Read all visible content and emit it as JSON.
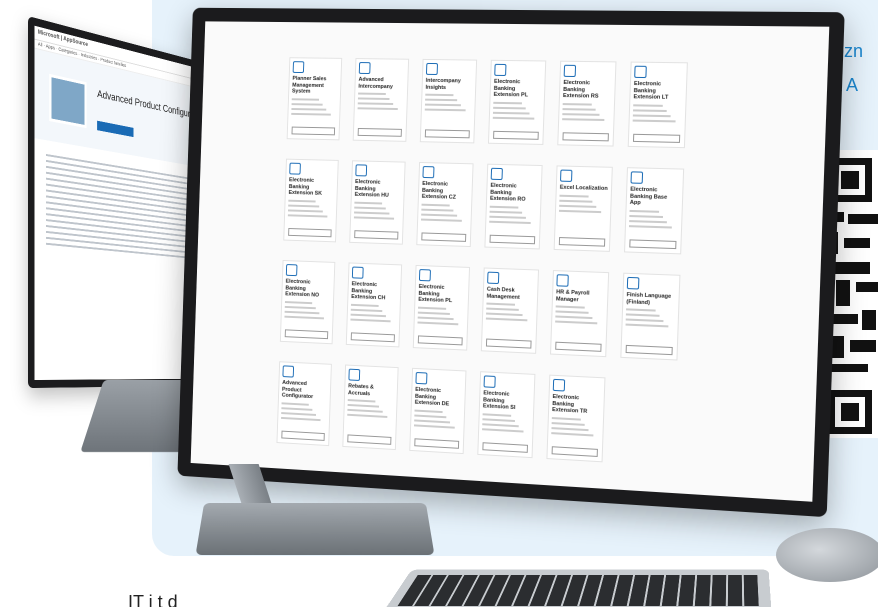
{
  "promo": {
    "line1": "Pozn",
    "line2": "na A"
  },
  "footer": {
    "text": "IT i t d"
  },
  "back_screen": {
    "brand": "Microsoft | AppSource",
    "nav_items": [
      "All",
      "Apps",
      "Categories",
      "Industries",
      "Product families"
    ],
    "app_title": "Advanced Product Configurator"
  },
  "front_screen": {
    "tiles": [
      {
        "name": "Planner Sales Management System"
      },
      {
        "name": "Advanced Intercompany"
      },
      {
        "name": "Intercompany Insights"
      },
      {
        "name": "Electronic Banking Extension PL"
      },
      {
        "name": "Electronic Banking Extension RS"
      },
      {
        "name": "Electronic Banking Extension LT"
      },
      {
        "name": "Electronic Banking Extension SK"
      },
      {
        "name": "Electronic Banking Extension HU"
      },
      {
        "name": "Electronic Banking Extension CZ"
      },
      {
        "name": "Electronic Banking Extension RO"
      },
      {
        "name": "Excel Localization"
      },
      {
        "name": "Electronic Banking Base App"
      },
      {
        "name": "Electronic Banking Extension NO"
      },
      {
        "name": "Electronic Banking Extension CH"
      },
      {
        "name": "Electronic Banking Extension PL"
      },
      {
        "name": "Cash Desk Management"
      },
      {
        "name": "HR & Payroll Manager"
      },
      {
        "name": "Finish Language (Finland)"
      },
      {
        "name": "Advanced Product Configurator"
      },
      {
        "name": "Rebates & Accruals"
      },
      {
        "name": "Electronic Banking Extension DE"
      },
      {
        "name": "Electronic Banking Extension SI"
      },
      {
        "name": "Electronic Banking Extension TR"
      }
    ]
  }
}
